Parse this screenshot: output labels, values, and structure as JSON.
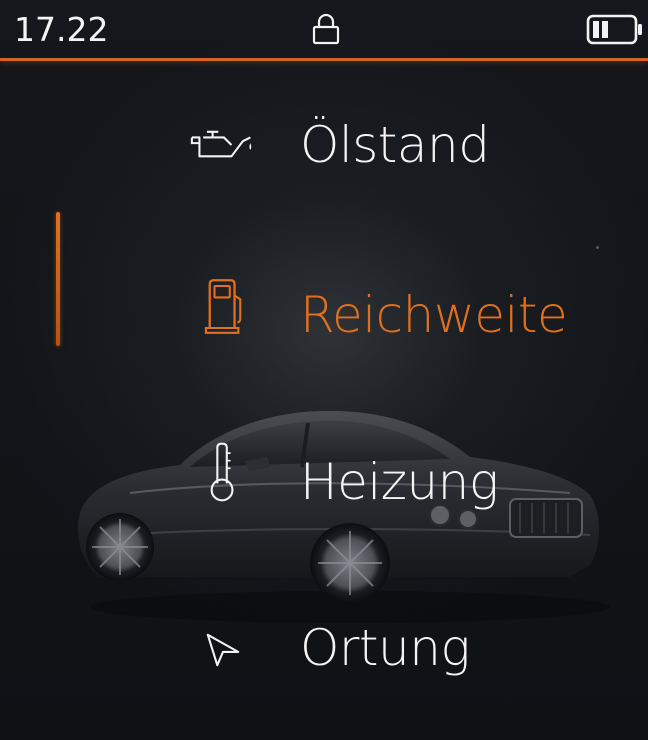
{
  "status_bar": {
    "time": "17.22",
    "lock_icon": "lock-icon",
    "battery_icon": "battery-icon",
    "battery_level": 0.4
  },
  "accent_color": "#e0701f",
  "menu": {
    "items": [
      {
        "label": "Ölstand",
        "icon": "oil-can-icon",
        "active": false
      },
      {
        "label": "Reichweite",
        "icon": "fuel-pump-icon",
        "active": true
      },
      {
        "label": "Heizung",
        "icon": "thermometer-icon",
        "active": false
      },
      {
        "label": "Ortung",
        "icon": "location-arrow-icon",
        "active": false
      }
    ]
  },
  "background_image": "car-image"
}
